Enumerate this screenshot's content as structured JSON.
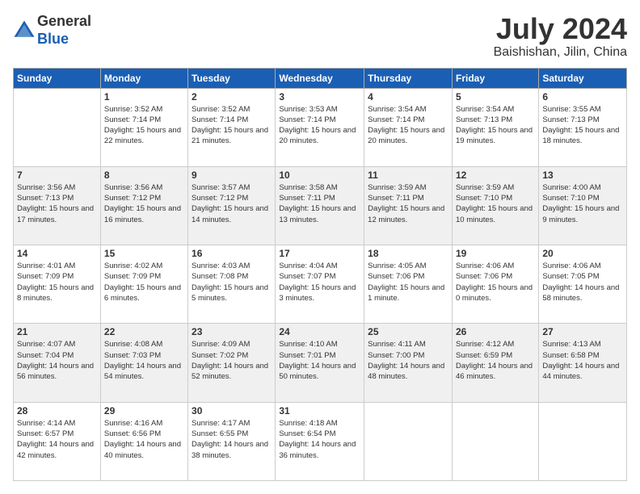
{
  "header": {
    "logo_line1": "General",
    "logo_line2": "Blue",
    "month_title": "July 2024",
    "location": "Baishishan, Jilin, China"
  },
  "weekdays": [
    "Sunday",
    "Monday",
    "Tuesday",
    "Wednesday",
    "Thursday",
    "Friday",
    "Saturday"
  ],
  "weeks": [
    [
      {
        "day": "",
        "sunrise": "",
        "sunset": "",
        "daylight": ""
      },
      {
        "day": "1",
        "sunrise": "Sunrise: 3:52 AM",
        "sunset": "Sunset: 7:14 PM",
        "daylight": "Daylight: 15 hours and 22 minutes."
      },
      {
        "day": "2",
        "sunrise": "Sunrise: 3:52 AM",
        "sunset": "Sunset: 7:14 PM",
        "daylight": "Daylight: 15 hours and 21 minutes."
      },
      {
        "day": "3",
        "sunrise": "Sunrise: 3:53 AM",
        "sunset": "Sunset: 7:14 PM",
        "daylight": "Daylight: 15 hours and 20 minutes."
      },
      {
        "day": "4",
        "sunrise": "Sunrise: 3:54 AM",
        "sunset": "Sunset: 7:14 PM",
        "daylight": "Daylight: 15 hours and 20 minutes."
      },
      {
        "day": "5",
        "sunrise": "Sunrise: 3:54 AM",
        "sunset": "Sunset: 7:13 PM",
        "daylight": "Daylight: 15 hours and 19 minutes."
      },
      {
        "day": "6",
        "sunrise": "Sunrise: 3:55 AM",
        "sunset": "Sunset: 7:13 PM",
        "daylight": "Daylight: 15 hours and 18 minutes."
      }
    ],
    [
      {
        "day": "7",
        "sunrise": "Sunrise: 3:56 AM",
        "sunset": "Sunset: 7:13 PM",
        "daylight": "Daylight: 15 hours and 17 minutes."
      },
      {
        "day": "8",
        "sunrise": "Sunrise: 3:56 AM",
        "sunset": "Sunset: 7:12 PM",
        "daylight": "Daylight: 15 hours and 16 minutes."
      },
      {
        "day": "9",
        "sunrise": "Sunrise: 3:57 AM",
        "sunset": "Sunset: 7:12 PM",
        "daylight": "Daylight: 15 hours and 14 minutes."
      },
      {
        "day": "10",
        "sunrise": "Sunrise: 3:58 AM",
        "sunset": "Sunset: 7:11 PM",
        "daylight": "Daylight: 15 hours and 13 minutes."
      },
      {
        "day": "11",
        "sunrise": "Sunrise: 3:59 AM",
        "sunset": "Sunset: 7:11 PM",
        "daylight": "Daylight: 15 hours and 12 minutes."
      },
      {
        "day": "12",
        "sunrise": "Sunrise: 3:59 AM",
        "sunset": "Sunset: 7:10 PM",
        "daylight": "Daylight: 15 hours and 10 minutes."
      },
      {
        "day": "13",
        "sunrise": "Sunrise: 4:00 AM",
        "sunset": "Sunset: 7:10 PM",
        "daylight": "Daylight: 15 hours and 9 minutes."
      }
    ],
    [
      {
        "day": "14",
        "sunrise": "Sunrise: 4:01 AM",
        "sunset": "Sunset: 7:09 PM",
        "daylight": "Daylight: 15 hours and 8 minutes."
      },
      {
        "day": "15",
        "sunrise": "Sunrise: 4:02 AM",
        "sunset": "Sunset: 7:09 PM",
        "daylight": "Daylight: 15 hours and 6 minutes."
      },
      {
        "day": "16",
        "sunrise": "Sunrise: 4:03 AM",
        "sunset": "Sunset: 7:08 PM",
        "daylight": "Daylight: 15 hours and 5 minutes."
      },
      {
        "day": "17",
        "sunrise": "Sunrise: 4:04 AM",
        "sunset": "Sunset: 7:07 PM",
        "daylight": "Daylight: 15 hours and 3 minutes."
      },
      {
        "day": "18",
        "sunrise": "Sunrise: 4:05 AM",
        "sunset": "Sunset: 7:06 PM",
        "daylight": "Daylight: 15 hours and 1 minute."
      },
      {
        "day": "19",
        "sunrise": "Sunrise: 4:06 AM",
        "sunset": "Sunset: 7:06 PM",
        "daylight": "Daylight: 15 hours and 0 minutes."
      },
      {
        "day": "20",
        "sunrise": "Sunrise: 4:06 AM",
        "sunset": "Sunset: 7:05 PM",
        "daylight": "Daylight: 14 hours and 58 minutes."
      }
    ],
    [
      {
        "day": "21",
        "sunrise": "Sunrise: 4:07 AM",
        "sunset": "Sunset: 7:04 PM",
        "daylight": "Daylight: 14 hours and 56 minutes."
      },
      {
        "day": "22",
        "sunrise": "Sunrise: 4:08 AM",
        "sunset": "Sunset: 7:03 PM",
        "daylight": "Daylight: 14 hours and 54 minutes."
      },
      {
        "day": "23",
        "sunrise": "Sunrise: 4:09 AM",
        "sunset": "Sunset: 7:02 PM",
        "daylight": "Daylight: 14 hours and 52 minutes."
      },
      {
        "day": "24",
        "sunrise": "Sunrise: 4:10 AM",
        "sunset": "Sunset: 7:01 PM",
        "daylight": "Daylight: 14 hours and 50 minutes."
      },
      {
        "day": "25",
        "sunrise": "Sunrise: 4:11 AM",
        "sunset": "Sunset: 7:00 PM",
        "daylight": "Daylight: 14 hours and 48 minutes."
      },
      {
        "day": "26",
        "sunrise": "Sunrise: 4:12 AM",
        "sunset": "Sunset: 6:59 PM",
        "daylight": "Daylight: 14 hours and 46 minutes."
      },
      {
        "day": "27",
        "sunrise": "Sunrise: 4:13 AM",
        "sunset": "Sunset: 6:58 PM",
        "daylight": "Daylight: 14 hours and 44 minutes."
      }
    ],
    [
      {
        "day": "28",
        "sunrise": "Sunrise: 4:14 AM",
        "sunset": "Sunset: 6:57 PM",
        "daylight": "Daylight: 14 hours and 42 minutes."
      },
      {
        "day": "29",
        "sunrise": "Sunrise: 4:16 AM",
        "sunset": "Sunset: 6:56 PM",
        "daylight": "Daylight: 14 hours and 40 minutes."
      },
      {
        "day": "30",
        "sunrise": "Sunrise: 4:17 AM",
        "sunset": "Sunset: 6:55 PM",
        "daylight": "Daylight: 14 hours and 38 minutes."
      },
      {
        "day": "31",
        "sunrise": "Sunrise: 4:18 AM",
        "sunset": "Sunset: 6:54 PM",
        "daylight": "Daylight: 14 hours and 36 minutes."
      },
      {
        "day": "",
        "sunrise": "",
        "sunset": "",
        "daylight": ""
      },
      {
        "day": "",
        "sunrise": "",
        "sunset": "",
        "daylight": ""
      },
      {
        "day": "",
        "sunrise": "",
        "sunset": "",
        "daylight": ""
      }
    ]
  ]
}
